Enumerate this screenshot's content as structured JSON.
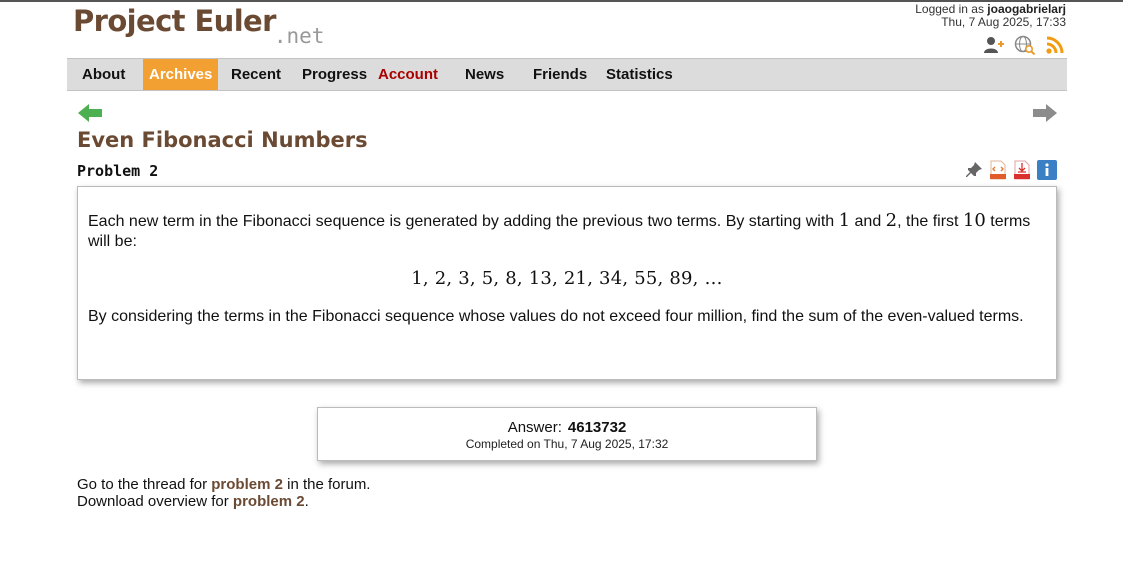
{
  "header": {
    "logo_main": "Project Euler",
    "logo_suffix": ".net",
    "logged_in_prefix": "Logged in as",
    "username": "joaogabrielarj",
    "datetime": "Thu, 7 Aug 2025, 17:33",
    "icons": [
      "add-friend-icon",
      "globe-search-icon",
      "rss-feed-icon"
    ]
  },
  "nav": {
    "items": [
      {
        "label": "About"
      },
      {
        "label": "Archives"
      },
      {
        "label": "Recent"
      },
      {
        "label": "Progress"
      },
      {
        "label": "Account"
      },
      {
        "label": "News"
      },
      {
        "label": "Friends"
      },
      {
        "label": "Statistics"
      }
    ],
    "active": "Archives",
    "active_color": "#f3a033",
    "account_color": "#aa0000"
  },
  "problem": {
    "title": "Even Fibonacci Numbers",
    "number_label": "Problem 2",
    "icons": [
      "pin-icon",
      "html-file-icon",
      "pdf-file-icon",
      "info-icon"
    ],
    "text1_a": "Each new term in the Fibonacci sequence is generated by adding the previous two terms. By starting with ",
    "text1_n1": "1",
    "text1_b": " and ",
    "text1_n2": "2",
    "text1_c": ", the first ",
    "text1_n3": "10",
    "text1_d": " terms will be:",
    "sequence": "1, 2, 3, 5, 8, 13, 21, 34, 55, 89, …",
    "text2": "By considering the terms in the Fibonacci sequence whose values do not exceed four million, find the sum of the even-valued terms."
  },
  "answer": {
    "label": "Answer:",
    "value": "4613732",
    "completed": "Completed on Thu, 7 Aug 2025, 17:32"
  },
  "footer": {
    "thread_prefix": "Go to the thread for ",
    "thread_link": "problem 2",
    "thread_suffix": " in the forum.",
    "download_prefix": "Download overview for ",
    "download_link": "problem 2",
    "download_suffix": "."
  },
  "colors": {
    "brand_brown": "#6b4a33",
    "back_arrow": "#4caf50",
    "forward_arrow": "#8c8c8c"
  }
}
